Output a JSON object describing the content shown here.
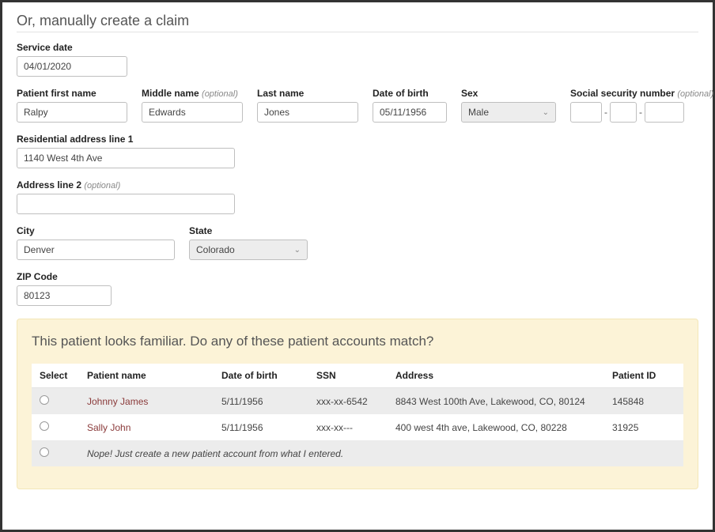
{
  "section_title": "Or, manually create a claim",
  "labels": {
    "service_date": "Service date",
    "first_name": "Patient first name",
    "middle_name": "Middle name",
    "last_name": "Last name",
    "dob": "Date of birth",
    "sex": "Sex",
    "ssn": "Social security number",
    "addr1": "Residential address line 1",
    "addr2": "Address line 2",
    "city": "City",
    "state": "State",
    "zip": "ZIP Code",
    "optional": "(optional)"
  },
  "values": {
    "service_date": "04/01/2020",
    "first_name": "Ralpy",
    "middle_name": "Edwards",
    "last_name": "Jones",
    "dob": "05/11/1956",
    "sex": "Male",
    "addr1": "1140 West 4th Ave",
    "addr2": "",
    "city": "Denver",
    "state": "Colorado",
    "zip": "80123",
    "ssn1": "",
    "ssn2": "",
    "ssn3": ""
  },
  "match": {
    "title": "This patient looks familiar. Do any of these patient accounts match?",
    "headers": {
      "select": "Select",
      "name": "Patient name",
      "dob": "Date of birth",
      "ssn": "SSN",
      "address": "Address",
      "pid": "Patient ID"
    },
    "rows": [
      {
        "name": "Johnny James",
        "dob": "5/11/1956",
        "ssn": "xxx-xx-6542",
        "address": "8843 West 100th Ave, Lakewood, CO, 80124",
        "pid": "145848"
      },
      {
        "name": "Sally John",
        "dob": "5/11/1956",
        "ssn": "xxx-xx---",
        "address": "400 west 4th ave, Lakewood, CO, 80228",
        "pid": "31925"
      }
    ],
    "none_label": "Nope! Just create a new patient account from what I entered."
  }
}
